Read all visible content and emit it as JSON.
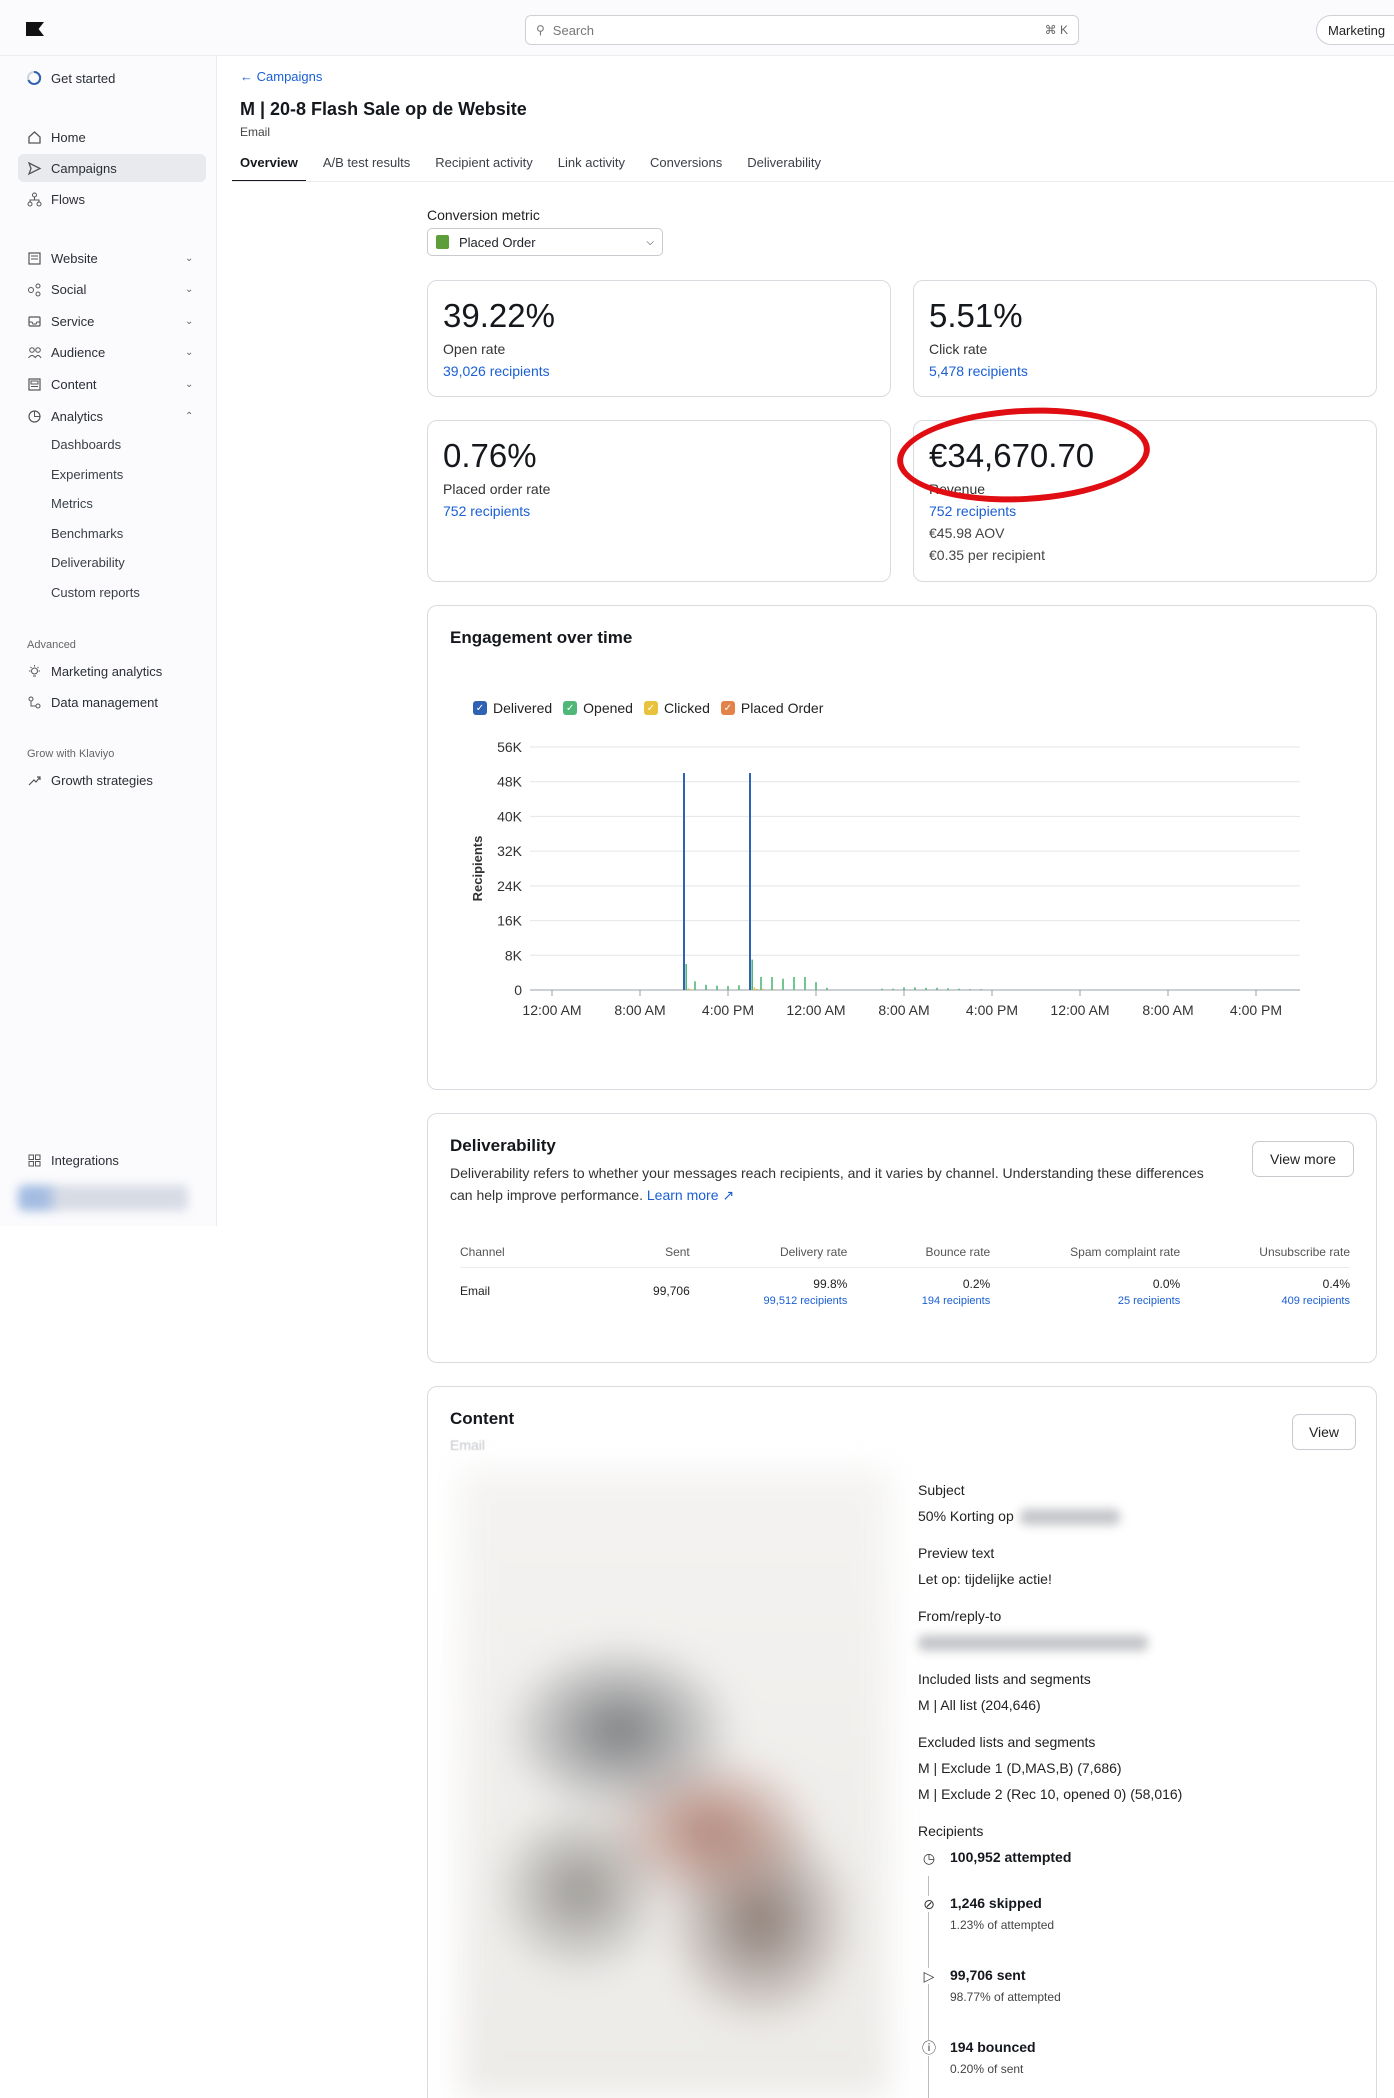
{
  "topbar": {
    "search_placeholder": "Search",
    "search_shortcut": "⌘ K",
    "account_button": "Marketing"
  },
  "sidebar": {
    "get_started": "Get started",
    "items": [
      {
        "label": "Home",
        "icon": "home-icon"
      },
      {
        "label": "Campaigns",
        "icon": "send-icon",
        "active": true
      },
      {
        "label": "Flows",
        "icon": "flows-icon"
      },
      {
        "label": "Website",
        "icon": "website-icon"
      },
      {
        "label": "Social",
        "icon": "social-icon"
      },
      {
        "label": "Service",
        "icon": "service-icon"
      },
      {
        "label": "Audience",
        "icon": "audience-icon"
      },
      {
        "label": "Content",
        "icon": "content-icon"
      },
      {
        "label": "Analytics",
        "icon": "analytics-icon"
      }
    ],
    "analytics_sub": [
      "Dashboards",
      "Experiments",
      "Metrics",
      "Benchmarks",
      "Deliverability",
      "Custom reports"
    ],
    "advanced_label": "Advanced",
    "advanced_items": [
      "Marketing analytics",
      "Data management"
    ],
    "grow_label": "Grow with Klaviyo",
    "grow_items": [
      "Growth strategies"
    ],
    "integrations": "Integrations"
  },
  "header": {
    "breadcrumb": "Campaigns",
    "title": "M | 20-8 Flash Sale op de Website",
    "channel": "Email",
    "tabs": [
      "Overview",
      "A/B test results",
      "Recipient activity",
      "Link activity",
      "Conversions",
      "Deliverability"
    ]
  },
  "conversion": {
    "label": "Conversion metric",
    "value": "Placed Order"
  },
  "stats": {
    "open": {
      "value": "39.22%",
      "label": "Open rate",
      "link": "39,026 recipients"
    },
    "click": {
      "value": "5.51%",
      "label": "Click rate",
      "link": "5,478 recipients"
    },
    "placed": {
      "value": "0.76%",
      "label": "Placed order rate",
      "link": "752 recipients"
    },
    "revenue": {
      "value": "€34,670.70",
      "label": "Revenue",
      "link": "752 recipients",
      "aov": "€45.98 AOV",
      "per_recipient": "€0.35 per recipient"
    }
  },
  "annotation": {
    "color": "#e00d13"
  },
  "engagement": {
    "title": "Engagement over time",
    "legend": [
      {
        "name": "Delivered",
        "color": "#2f62b3"
      },
      {
        "name": "Opened",
        "color": "#4fb878"
      },
      {
        "name": "Clicked",
        "color": "#e8c23c"
      },
      {
        "name": "Placed Order",
        "color": "#e3834a"
      }
    ]
  },
  "chart_data": {
    "type": "bar",
    "ylabel": "Recipients",
    "xlabel": "",
    "ylim": [
      0,
      56000
    ],
    "yticks": [
      "0",
      "8K",
      "16K",
      "24K",
      "32K",
      "40K",
      "48K",
      "56K"
    ],
    "xticks": [
      "12:00 AM",
      "8:00 AM",
      "4:00 PM",
      "12:00 AM",
      "8:00 AM",
      "4:00 PM",
      "12:00 AM",
      "8:00 AM",
      "4:00 PM"
    ],
    "x_hours": [
      0,
      8,
      16,
      24,
      32,
      40,
      48,
      56,
      64
    ],
    "grid": true,
    "legend_position": "top-left",
    "series": [
      {
        "name": "Delivered",
        "hours": [
          12.0,
          18.0
        ],
        "values": [
          50000,
          50000
        ]
      },
      {
        "name": "Opened",
        "hours": [
          12.2,
          13.0,
          14.0,
          15.0,
          16.0,
          17.0,
          18.2,
          19.0,
          20.0,
          21.0,
          22.0,
          23.0,
          24.0,
          25.0,
          30.0,
          31.0,
          32.0,
          33.0,
          34.0,
          35.0,
          36.0,
          37.0,
          38.0,
          39.0
        ],
        "values": [
          6000,
          2000,
          1200,
          1000,
          900,
          1100,
          7000,
          3000,
          3000,
          2600,
          3000,
          3000,
          1800,
          500,
          300,
          300,
          600,
          600,
          500,
          500,
          400,
          300,
          200,
          200
        ]
      },
      {
        "name": "Clicked",
        "hours": [
          12.4,
          18.4,
          19.2,
          20.2
        ],
        "values": [
          400,
          600,
          300,
          200
        ]
      },
      {
        "name": "Placed Order",
        "hours": [
          12.6,
          18.6
        ],
        "values": [
          150,
          200
        ]
      }
    ]
  },
  "deliverability": {
    "title": "Deliverability",
    "description": "Deliverability refers to whether your messages reach recipients, and it varies by channel. Understanding these differences can help improve performance.",
    "learn_more": "Learn more",
    "view_more": "View more",
    "columns": [
      "Channel",
      "Sent",
      "Delivery rate",
      "Bounce rate",
      "Spam complaint rate",
      "Unsubscribe rate"
    ],
    "row": {
      "channel": "Email",
      "sent": "99,706",
      "delivery_rate": "99.8%",
      "delivery_recipients": "99,512 recipients",
      "bounce_rate": "0.2%",
      "bounce_recipients": "194 recipients",
      "spam_rate": "0.0%",
      "spam_recipients": "25 recipients",
      "unsub_rate": "0.4%",
      "unsub_recipients": "409 recipients"
    }
  },
  "content": {
    "title": "Content",
    "channel": "Email",
    "view": "View",
    "subject_label": "Subject",
    "subject_value": "50% Korting op",
    "preview_label": "Preview text",
    "preview_value": "Let op: tijdelijke actie!",
    "from_label": "From/reply-to",
    "included_label": "Included lists and segments",
    "included_value": "M | All list (204,646)",
    "excluded_label": "Excluded lists and segments",
    "excluded_1": "M | Exclude 1 (D,MAS,B) (7,686)",
    "excluded_2": "M | Exclude 2 (Rec 10, opened 0) (58,016)",
    "recipients_label": "Recipients",
    "attempted": "100,952 attempted",
    "skipped": "1,246 skipped",
    "skipped_sub": "1.23% of attempted",
    "sent": "99,706 sent",
    "sent_sub": "98.77% of attempted",
    "bounced": "194 bounced",
    "bounced_sub": "0.20% of sent"
  }
}
